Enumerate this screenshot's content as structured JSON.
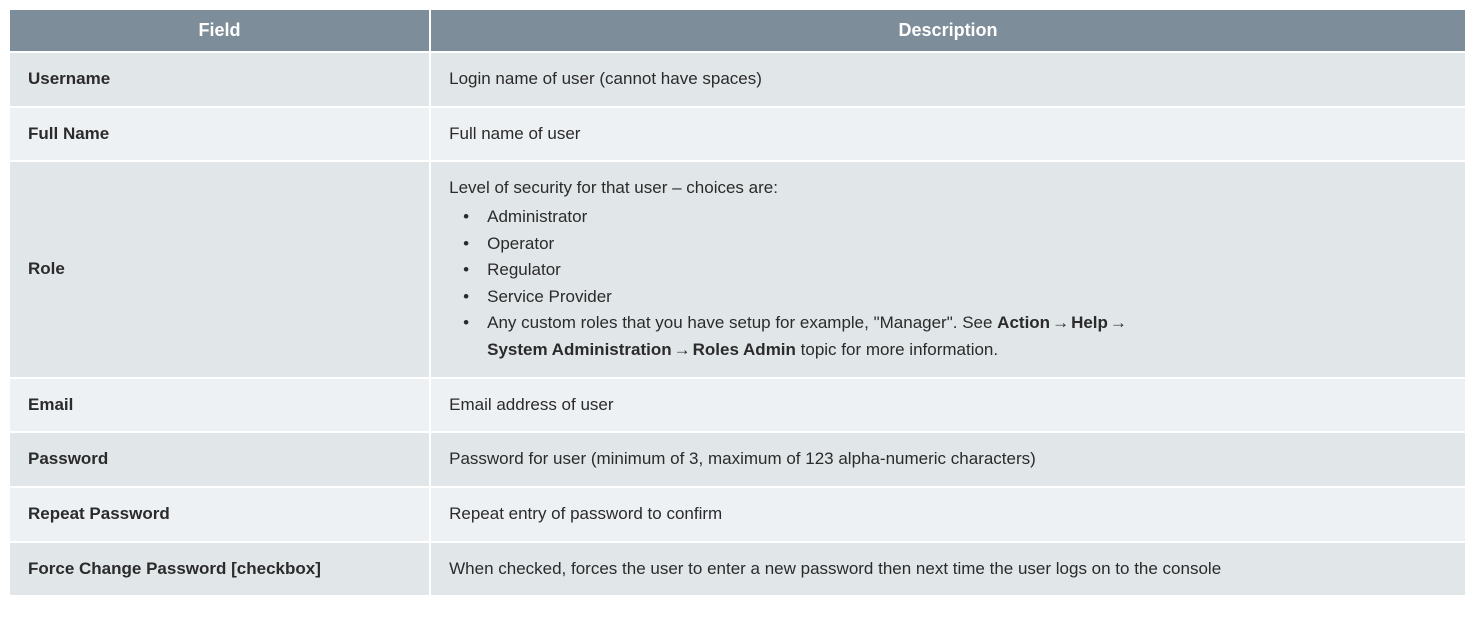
{
  "headers": {
    "field": "Field",
    "description": "Description"
  },
  "rows": [
    {
      "field": "Username",
      "desc": "Login name of user (cannot have spaces)"
    },
    {
      "field": "Full Name",
      "desc": "Full name of user"
    },
    {
      "field": "Role",
      "lead": "Level of security for that user – choices are:",
      "items": [
        "Administrator",
        "Operator",
        "Regulator",
        "Service Provider"
      ],
      "custom_prefix": "Any custom roles that you have setup for example, \"Manager\". See ",
      "path": [
        "Action",
        "Help",
        "System Administration",
        "Roles Admin"
      ],
      "custom_suffix": " topic for more information."
    },
    {
      "field": "Email",
      "desc": "Email address of user"
    },
    {
      "field": "Password",
      "desc": "Password for user (minimum of 3, maximum of 123 alpha-numeric characters)"
    },
    {
      "field": "Repeat Password",
      "desc": "Repeat entry of password to confirm"
    },
    {
      "field": "Force Change Password [checkbox]",
      "desc": "When checked, forces the user to enter a new password then next time the user logs on to the console"
    }
  ],
  "arrow_glyph": "→"
}
